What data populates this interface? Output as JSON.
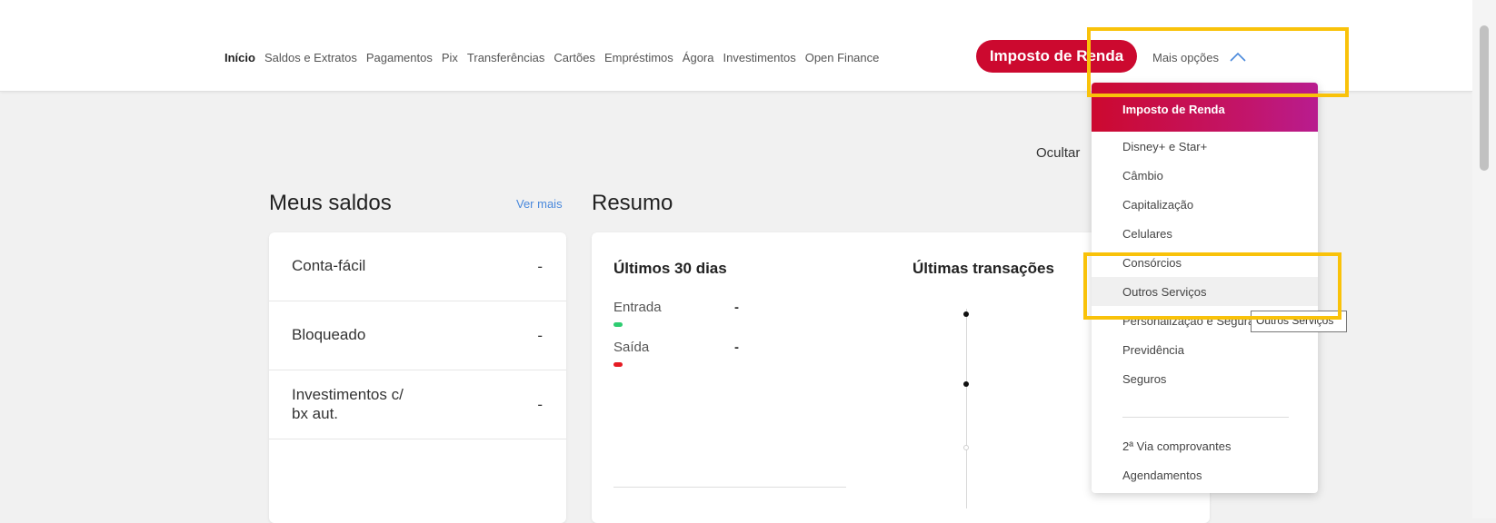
{
  "nav": {
    "items": [
      {
        "label": "Início",
        "active": true
      },
      {
        "label": "Saldos e Extratos"
      },
      {
        "label": "Pagamentos"
      },
      {
        "label": "Pix"
      },
      {
        "label": "Transferências"
      },
      {
        "label": "Cartões"
      },
      {
        "label": "Empréstimos"
      },
      {
        "label": "Ágora"
      },
      {
        "label": "Investimentos"
      },
      {
        "label": "Open Finance"
      }
    ],
    "cta_label": "Imposto de Renda",
    "more_label": "Mais opções",
    "more_icon": "chevron-up-icon"
  },
  "main": {
    "ocultar_label": "Ocultar",
    "saldos_title": "Meus saldos",
    "ver_mais_label": "Ver mais",
    "resumo_title": "Resumo",
    "saldos": [
      {
        "label": "Conta-fácil",
        "value": "-"
      },
      {
        "label": "Bloqueado",
        "value": "-"
      },
      {
        "label": "Investimentos c/ bx aut.",
        "value": "-"
      }
    ],
    "ultimos_title": "Últimos 30 dias",
    "entrada_label": "Entrada",
    "entrada_value": "-",
    "saida_label": "Saída",
    "saida_value": "-",
    "transacoes_title": "Últimas transações"
  },
  "dropdown": {
    "header": "Imposto de Renda",
    "items": [
      "Disney+ e Star+",
      "Câmbio",
      "Capitalização",
      "Celulares",
      "Consórcios",
      "Outros Serviços",
      "Personalização e Segurança",
      "Previdência",
      "Seguros"
    ],
    "footer_items": [
      "2ª Via comprovantes",
      "Agendamentos"
    ],
    "hovered": "Outros Serviços"
  },
  "tooltip": "Outros Serviços",
  "colors": {
    "brand_red": "#cc092f",
    "gradient_end": "#b81c8f",
    "highlight": "#f9c20a",
    "entrada": "#2ecc71",
    "saida": "#e51b23",
    "link": "#4a89dc"
  }
}
